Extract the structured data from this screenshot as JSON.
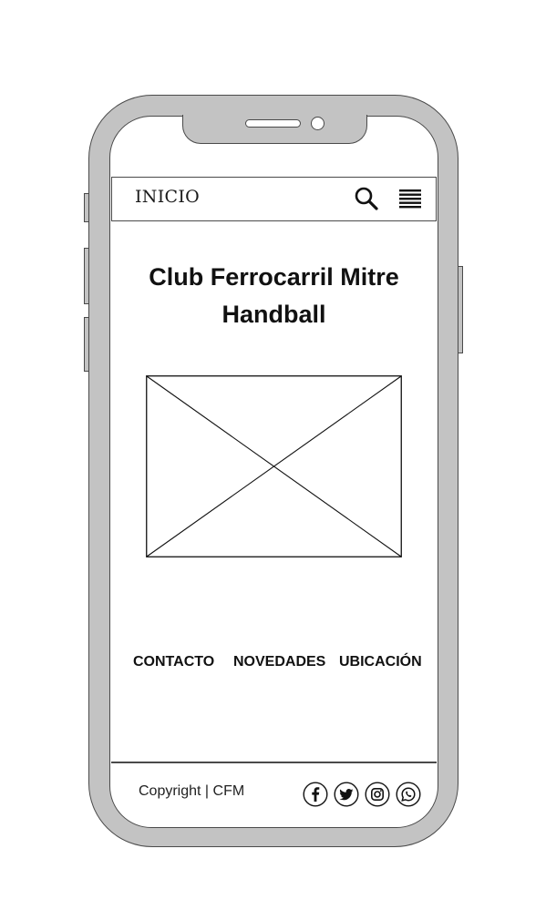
{
  "header": {
    "title": "INICIO",
    "search_icon": "search-icon",
    "menu_icon": "hamburger-menu-icon"
  },
  "main": {
    "title_line1": "Club Ferrocarril Mitre",
    "title_line2": "Handball",
    "image": "image-placeholder"
  },
  "links": [
    {
      "label": "CONTACTO"
    },
    {
      "label": "NOVEDADES"
    },
    {
      "label": "UBICACIÓN"
    }
  ],
  "footer": {
    "copyright": "Copyright | CFM",
    "social_icons": [
      "facebook-icon",
      "twitter-icon",
      "instagram-icon",
      "whatsapp-icon"
    ]
  },
  "colors": {
    "frame": "#c3c3c3",
    "outline": "#4a4a4a",
    "screen": "#ffffff",
    "text": "#111111"
  }
}
